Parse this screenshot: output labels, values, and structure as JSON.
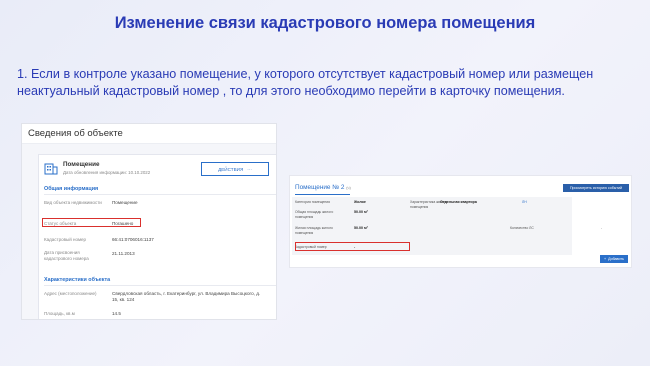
{
  "slide": {
    "title": "Изменение связи кадастрового номера помещения",
    "instruction": "1. Если в контроле указано помещение, у которого отсутствует кадастровый номер или размещен неактуальный кадастровый номер , то для этого необходимо перейти в карточку помещения."
  },
  "left_panel": {
    "header": "Сведения об объекте",
    "object_name": "Помещение",
    "update_date": "Дата обновления информации: 10.10.2022",
    "actions_button": "ДЕЙСТВИЯ",
    "actions_icon": "more-dots",
    "general_section": "Общая информация",
    "fields": [
      {
        "label": "Вид объекта недвижимости",
        "value": "Помещение"
      },
      {
        "label": "Статус объекта",
        "value": "Погашено"
      },
      {
        "label": "Кадастровый номер",
        "value": "66:41:0706016:1137"
      },
      {
        "label": "Дата присвоения кадастрового номера",
        "value": "21.11.2013"
      }
    ],
    "characteristics_section": "Характеристики объекта",
    "char_fields": [
      {
        "label": "Адрес (местоположение)",
        "value": "Свердловская область, г. Екатеринбург, ул. Владимира Высоцкого, д. 15, кв. 124"
      },
      {
        "label": "Площадь, кв.м",
        "value": "14.5"
      }
    ]
  },
  "right_panel": {
    "title": "Помещение № 2",
    "title_suffix": "(ч)",
    "history_button": "Просмотреть историю событий",
    "rows": [
      {
        "label": "Категория помещения",
        "value": "Жилое"
      },
      {
        "label": "Общая площадь жилого помещения",
        "value": "50.00 м²"
      },
      {
        "label": "Жилая площадь жилого помещения",
        "value": "50.00 м²"
      },
      {
        "label": "Кадастровый номер",
        "value": "-"
      }
    ],
    "mid_label": "Характеристика жилого помещения",
    "mid_value": "Отдельная квартира",
    "right_col1": "ЛН",
    "right_col2": "Количество ЛС",
    "right_col2_value": "-",
    "add_button": "Добавить",
    "add_icon": "plus"
  },
  "colors": {
    "title_blue": "#2a3bb5",
    "link_blue": "#2a6fc9",
    "highlight_red": "#d9302d"
  }
}
